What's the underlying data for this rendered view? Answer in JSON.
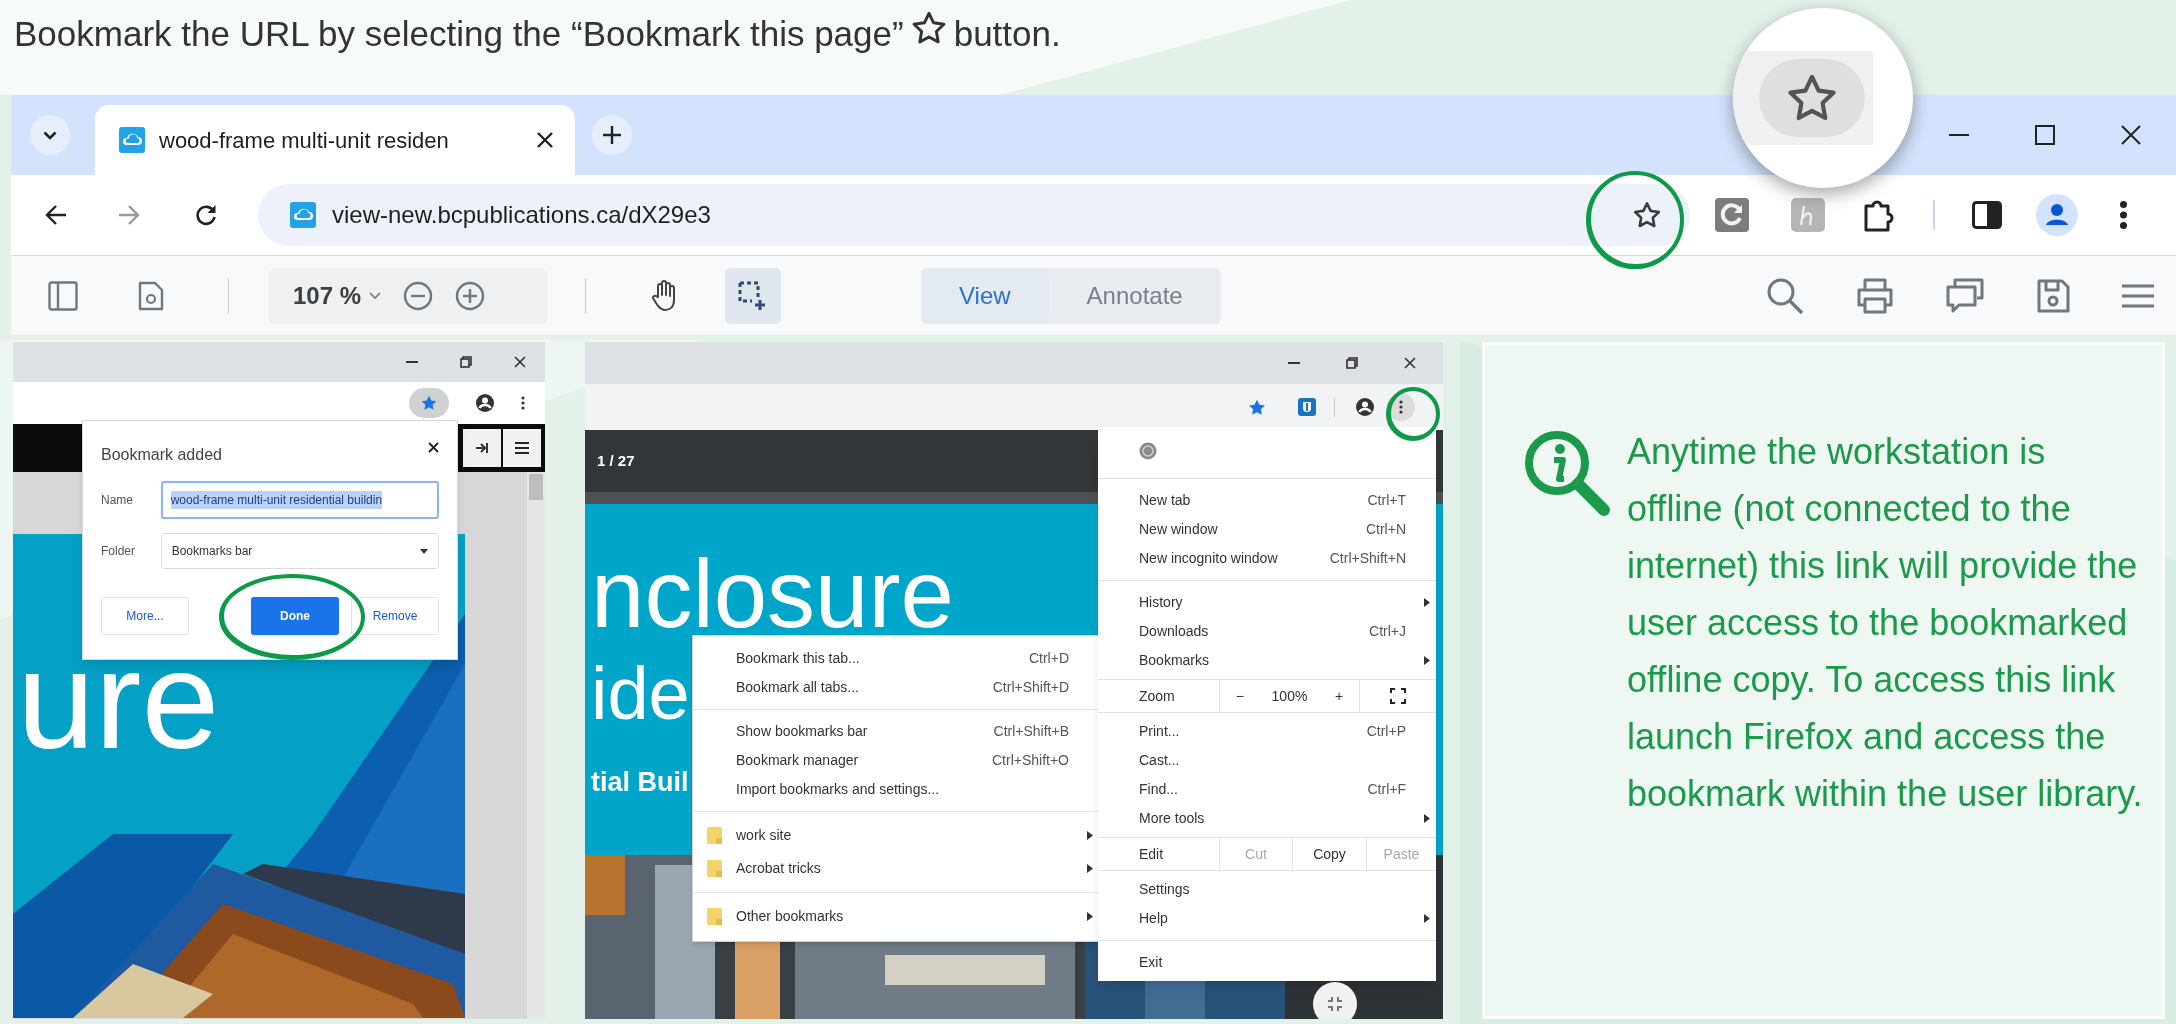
{
  "instruction": {
    "text_before": "Bookmark the URL by selecting the “Bookmark this page”",
    "text_after": "button."
  },
  "browser": {
    "tabs": [
      {
        "title": "wood-frame multi-unit residen",
        "selected": true
      }
    ],
    "url": "view-new.bcpublications.ca/dX29e3",
    "bookmarked": false,
    "pdf_toolbar": {
      "zoom": "107 %",
      "modes": [
        {
          "label": "View",
          "selected": true
        },
        {
          "label": "Annotate",
          "selected": false
        }
      ]
    }
  },
  "step_1": {
    "bookmarked": true,
    "cover_text": "ure",
    "dialog": {
      "title": "Bookmark added",
      "fields": [
        {
          "label": "Name",
          "value": "wood-frame multi-unit residential buildin",
          "kind": "text",
          "highlighted": true
        },
        {
          "label": "Folder",
          "value": "Bookmarks bar",
          "kind": "dropdown",
          "highlighted": false
        }
      ],
      "buttons": [
        {
          "label": "More...",
          "kind": "secondary"
        },
        {
          "label": "Done",
          "kind": "primary"
        },
        {
          "label": "Remove",
          "kind": "secondary"
        }
      ]
    }
  },
  "step_2": {
    "bookmarked": true,
    "page_counter": "1 / 27",
    "cover_lines": [
      "nclosure",
      "ide",
      "tial Buil"
    ],
    "bookmarks_menu": [
      {
        "kind": "item",
        "label": "Bookmark this tab...",
        "shortcut": "Ctrl+D",
        "submenu": false
      },
      {
        "kind": "item",
        "label": "Bookmark all tabs...",
        "shortcut": "Ctrl+Shift+D",
        "submenu": false
      },
      {
        "kind": "separator"
      },
      {
        "kind": "item",
        "label": "Show bookmarks bar",
        "shortcut": "Ctrl+Shift+B",
        "submenu": false
      },
      {
        "kind": "item",
        "label": "Bookmark manager",
        "shortcut": "Ctrl+Shift+O",
        "submenu": false
      },
      {
        "kind": "item",
        "label": "Import bookmarks and settings...",
        "submenu": false
      },
      {
        "kind": "separator"
      },
      {
        "kind": "folder",
        "label": "work site",
        "submenu": true
      },
      {
        "kind": "folder",
        "label": "Acrobat tricks",
        "submenu": true
      },
      {
        "kind": "separator"
      },
      {
        "kind": "folder",
        "label": "Other bookmarks",
        "submenu": true
      }
    ],
    "main_menu": [
      {
        "kind": "icon"
      },
      {
        "kind": "separator"
      },
      {
        "kind": "item",
        "label": "New tab",
        "shortcut": "Ctrl+T",
        "submenu": false
      },
      {
        "kind": "item",
        "label": "New window",
        "shortcut": "Ctrl+N",
        "submenu": false
      },
      {
        "kind": "item",
        "label": "New incognito window",
        "shortcut": "Ctrl+Shift+N",
        "submenu": false
      },
      {
        "kind": "separator"
      },
      {
        "kind": "item",
        "label": "History",
        "submenu": true
      },
      {
        "kind": "item",
        "label": "Downloads",
        "shortcut": "Ctrl+J",
        "submenu": false
      },
      {
        "kind": "item",
        "label": "Bookmarks",
        "submenu": true
      },
      {
        "kind": "zoom",
        "label": "Zoom",
        "minus": "−",
        "value": "100%",
        "plus": "+"
      },
      {
        "kind": "item",
        "label": "Print...",
        "shortcut": "Ctrl+P",
        "submenu": false
      },
      {
        "kind": "item",
        "label": "Cast...",
        "submenu": false
      },
      {
        "kind": "item",
        "label": "Find...",
        "shortcut": "Ctrl+F",
        "submenu": false
      },
      {
        "kind": "item",
        "label": "More tools",
        "submenu": true
      },
      {
        "kind": "edit",
        "label": "Edit",
        "actions": [
          {
            "label": "Cut",
            "disabled": true
          },
          {
            "label": "Copy",
            "disabled": false
          },
          {
            "label": "Paste",
            "disabled": true
          }
        ]
      },
      {
        "kind": "item",
        "label": "Settings",
        "submenu": false
      },
      {
        "kind": "item",
        "label": "Help",
        "submenu": true
      },
      {
        "kind": "separator"
      },
      {
        "kind": "item",
        "label": "Exit",
        "submenu": false
      }
    ]
  },
  "note": {
    "text": "Anytime the workstation is offline (not connected to the internet) this link will provide the user access to the bookmarked offline copy. To access this link launch Firefox and access the bookmark within the user library."
  }
}
